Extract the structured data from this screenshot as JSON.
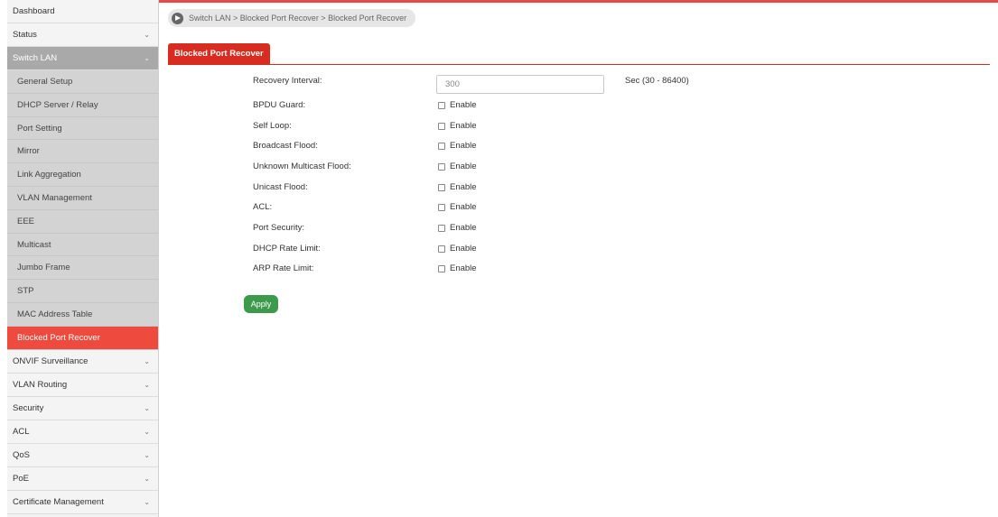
{
  "breadcrumb": {
    "text": "Switch LAN > Blocked Port Recover  > Blocked Port Recover"
  },
  "sidebar": {
    "top_items": [
      {
        "label": "Dashboard",
        "chevron": ""
      },
      {
        "label": "Status",
        "chevron": "⌄"
      }
    ],
    "section": {
      "label": "Switch LAN",
      "chevron": "⌄"
    },
    "sub_items": [
      {
        "label": "General Setup"
      },
      {
        "label": "DHCP Server / Relay"
      },
      {
        "label": "Port Setting"
      },
      {
        "label": "Mirror"
      },
      {
        "label": "Link Aggregation"
      },
      {
        "label": "VLAN Management"
      },
      {
        "label": "EEE"
      },
      {
        "label": "Multicast"
      },
      {
        "label": "Jumbo Frame"
      },
      {
        "label": "STP"
      },
      {
        "label": "MAC Address Table"
      },
      {
        "label": "Blocked Port Recover"
      }
    ],
    "bottom_items": [
      {
        "label": "ONVIF Surveillance",
        "chevron": "⌄"
      },
      {
        "label": "VLAN Routing",
        "chevron": "⌄"
      },
      {
        "label": "Security",
        "chevron": "⌄"
      },
      {
        "label": "ACL",
        "chevron": "⌄"
      },
      {
        "label": "QoS",
        "chevron": "⌄"
      },
      {
        "label": "PoE",
        "chevron": "⌄"
      },
      {
        "label": "Certificate Management",
        "chevron": "⌄"
      }
    ]
  },
  "tab": {
    "label": "Blocked Port Recover"
  },
  "form": {
    "recovery_interval": {
      "label": "Recovery Interval:",
      "value": "300",
      "hint": "Sec (30 - 86400)"
    },
    "checkbox_label": "Enable",
    "rows": [
      {
        "label": "BPDU Guard:",
        "checked": false
      },
      {
        "label": "Self Loop:",
        "checked": false
      },
      {
        "label": "Broadcast Flood:",
        "checked": false
      },
      {
        "label": "Unknown Multicast Flood:",
        "checked": false
      },
      {
        "label": "Unicast Flood:",
        "checked": false
      },
      {
        "label": "ACL:",
        "checked": false
      },
      {
        "label": "Port Security:",
        "checked": false
      },
      {
        "label": "DHCP Rate Limit:",
        "checked": false
      },
      {
        "label": "ARP Rate Limit:",
        "checked": false
      }
    ],
    "apply_label": "Apply"
  },
  "colors": {
    "accent": "#d82c20",
    "active_item": "#ee4b3e",
    "apply": "#3d9a4d"
  }
}
